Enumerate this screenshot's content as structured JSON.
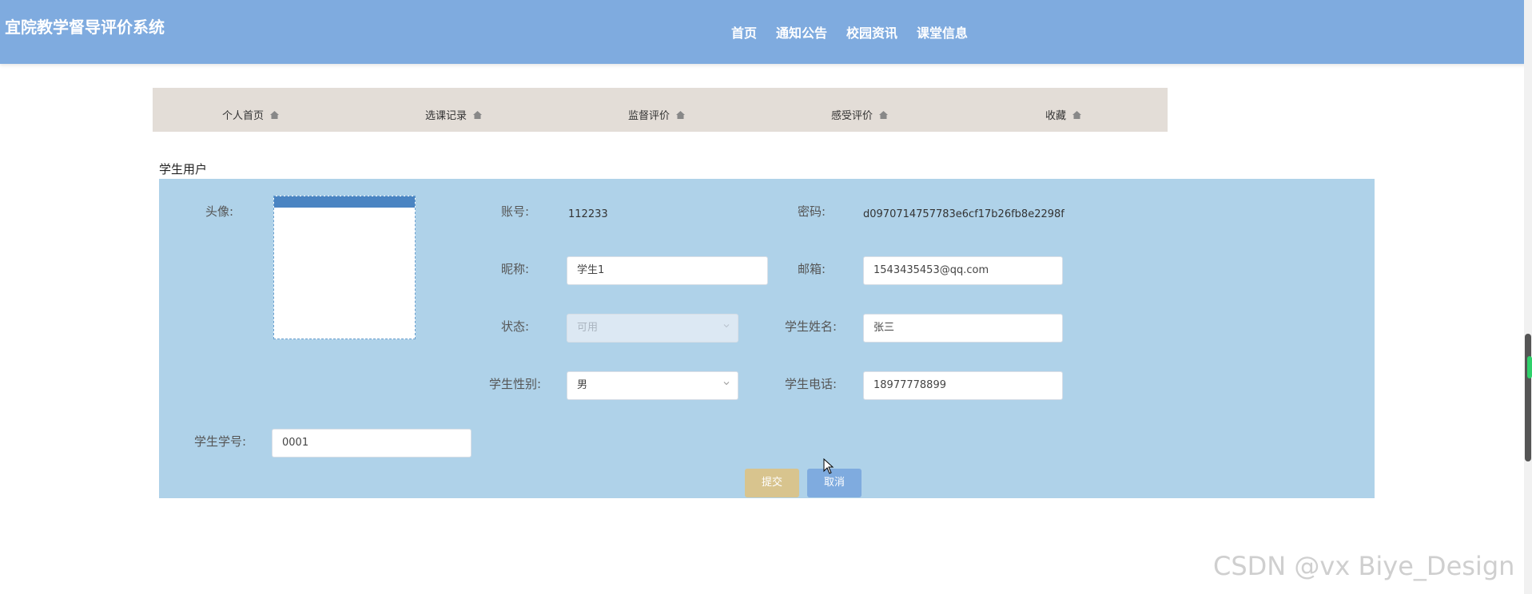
{
  "app": {
    "title": "宜院教学督导评价系统"
  },
  "nav": {
    "items": [
      "首页",
      "通知公告",
      "校园资讯",
      "课堂信息"
    ]
  },
  "subnav": {
    "items": [
      "个人首页",
      "选课记录",
      "监督评价",
      "感受评价",
      "收藏"
    ]
  },
  "section": {
    "title": "学生用户"
  },
  "form": {
    "avatar_label": "头像:",
    "account_label": "账号:",
    "account_value": "112233",
    "password_label": "密码:",
    "password_value": "d0970714757783e6cf17b26fb8e2298f",
    "nickname_label": "昵称:",
    "nickname_value": "学生1",
    "email_label": "邮箱:",
    "email_value": "1543435453@qq.com",
    "status_label": "状态:",
    "status_value": "可用",
    "name_label": "学生姓名:",
    "name_value": "张三",
    "gender_label": "学生性别:",
    "gender_value": "男",
    "phone_label": "学生电话:",
    "phone_value": "18977778899",
    "student_no_label": "学生学号:",
    "student_no_value": "0001"
  },
  "buttons": {
    "submit": "提交",
    "cancel": "取消"
  },
  "watermark": "CSDN @vx  Biye_Design",
  "colors": {
    "header": "#7fabdf",
    "panel": "#afd2e9",
    "subnav": "#e3ddd7",
    "submit": "#d8c48e",
    "cancel": "#7fabdf"
  }
}
